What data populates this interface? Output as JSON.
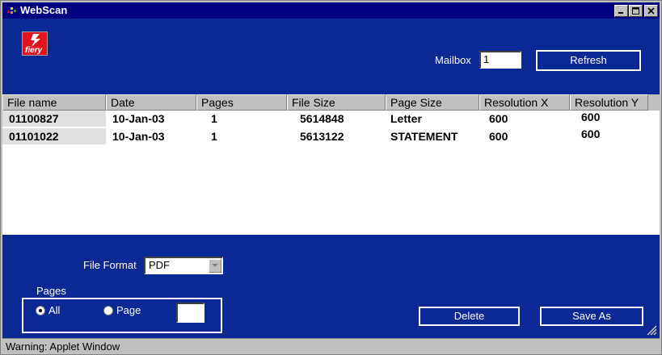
{
  "window": {
    "title": "WebScan"
  },
  "header": {
    "logo_text": "fiery",
    "mailbox_label": "Mailbox",
    "mailbox_value": "1",
    "refresh_label": "Refresh"
  },
  "table": {
    "columns": [
      "File name",
      "Date",
      "Pages",
      "File Size",
      "Page Size",
      "Resolution X",
      "Resolution Y"
    ],
    "rows": [
      [
        "01100827",
        "10-Jan-03",
        "1",
        "5614848",
        "Letter",
        "600",
        "600"
      ],
      [
        "01101022",
        "10-Jan-03",
        "1",
        "5613122",
        "STATEMENT",
        "600",
        "600"
      ]
    ]
  },
  "footer": {
    "file_format_label": "File Format",
    "file_format_value": "PDF",
    "pages_legend": "Pages",
    "radio_all_label": "All",
    "radio_page_label": "Page",
    "page_input_value": "",
    "delete_label": "Delete",
    "save_as_label": "Save As"
  },
  "status": {
    "text": "Warning: Applet Window"
  },
  "colors": {
    "title_bar": "#000080",
    "panel_blue": "#0a2994",
    "logo_red": "#e3141b",
    "chrome": "#c0c0c0"
  },
  "icons": {
    "title_icon": "java-applet-icon",
    "minimize": "minimize-icon",
    "maximize": "maximize-icon",
    "close": "close-icon",
    "dropdown": "chevron-down-icon",
    "resize": "resize-grip-icon"
  }
}
